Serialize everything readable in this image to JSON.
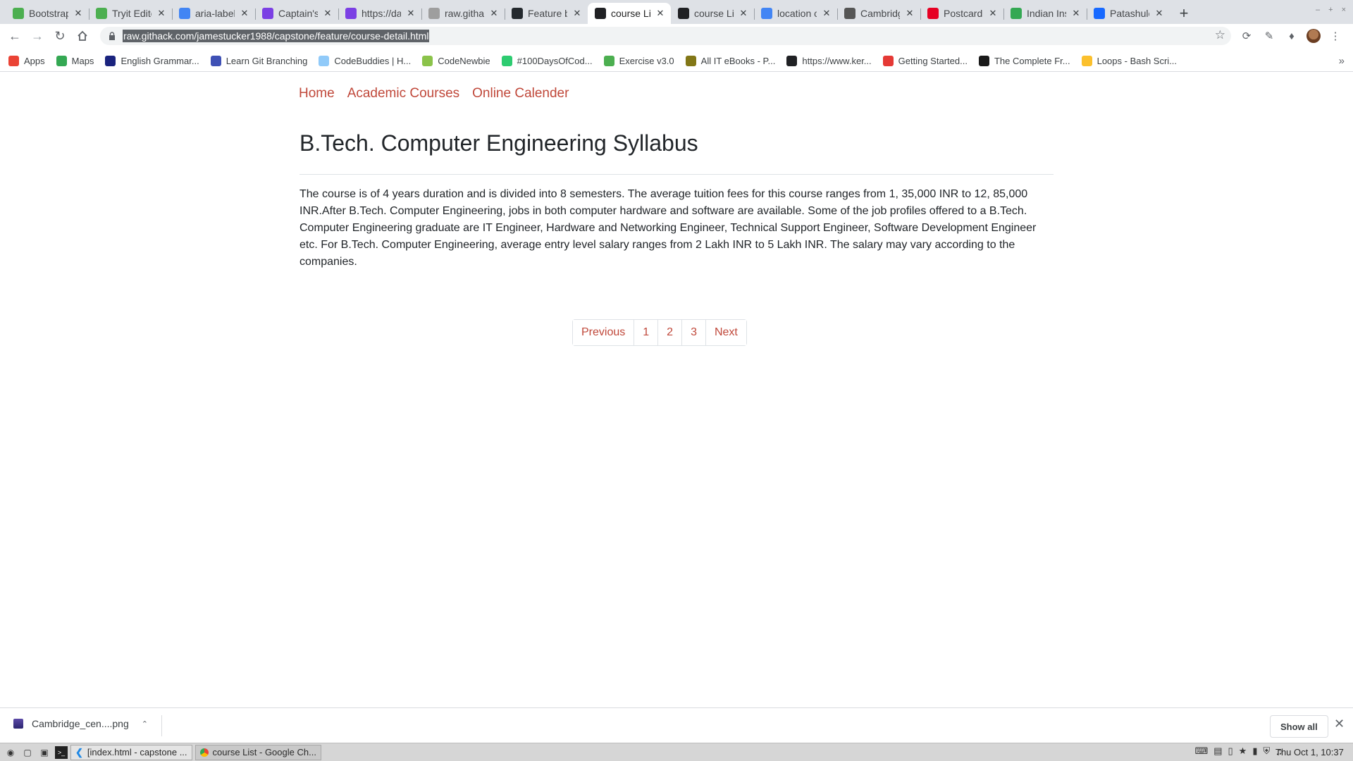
{
  "browser": {
    "tabs": [
      {
        "title": "Bootstrap",
        "icon": "tryit-icon",
        "color": "#4caf50",
        "active": false
      },
      {
        "title": "Tryit Editor",
        "icon": "tryit-icon",
        "color": "#4caf50",
        "active": false
      },
      {
        "title": "aria-label",
        "icon": "google-icon",
        "color": "#4285f4",
        "active": false
      },
      {
        "title": "Captain's Log",
        "icon": "mdn-icon",
        "color": "#7b3fe4",
        "active": false
      },
      {
        "title": "https://dat",
        "icon": "mdn-icon",
        "color": "#7b3fe4",
        "active": false
      },
      {
        "title": "raw.githack",
        "icon": "githack-icon",
        "color": "#9e9e9e",
        "active": false
      },
      {
        "title": "Feature by",
        "icon": "github-icon",
        "color": "#24292e",
        "active": false
      },
      {
        "title": "course List",
        "icon": "globe-icon",
        "color": "#202124",
        "active": true
      },
      {
        "title": "course List",
        "icon": "globe-icon",
        "color": "#202124",
        "active": false
      },
      {
        "title": "location of",
        "icon": "google-icon",
        "color": "#4285f4",
        "active": false
      },
      {
        "title": "Cambridge",
        "icon": "wikipedia-icon",
        "color": "#555555",
        "active": false
      },
      {
        "title": "Postcard",
        "icon": "pinterest-icon",
        "color": "#e60023",
        "active": false
      },
      {
        "title": "Indian Insti",
        "icon": "maps-icon",
        "color": "#34a853",
        "active": false
      },
      {
        "title": "Patashule",
        "icon": "behance-icon",
        "color": "#1769ff",
        "active": false
      }
    ],
    "url": "raw.githack.com/jamestucker1988/capstone/feature/course-detail.html",
    "bookmarks": [
      {
        "label": "Apps",
        "icon": "apps-grid-icon",
        "color": "#ea4335"
      },
      {
        "label": "Maps",
        "icon": "maps-icon",
        "color": "#34a853"
      },
      {
        "label": "English Grammar...",
        "icon": "power-icon",
        "color": "#1a237e"
      },
      {
        "label": "Learn Git Branching",
        "icon": "git-branch-icon",
        "color": "#3f51b5"
      },
      {
        "label": "CodeBuddies | H...",
        "icon": "codebuddies-icon",
        "color": "#90caf9"
      },
      {
        "label": "CodeNewbie",
        "icon": "codenewbie-icon",
        "color": "#8bc34a"
      },
      {
        "label": "#100DaysOfCod...",
        "icon": "hundred-days-icon",
        "color": "#2ecc71"
      },
      {
        "label": "Exercise v3.0",
        "icon": "tryit-icon",
        "color": "#4caf50"
      },
      {
        "label": "All IT eBooks - P...",
        "icon": "books-icon",
        "color": "#827717"
      },
      {
        "label": "https://www.ker...",
        "icon": "globe-icon",
        "color": "#202124"
      },
      {
        "label": "Getting Started...",
        "icon": "pen-icon",
        "color": "#e53935"
      },
      {
        "label": "The Complete Fr...",
        "icon": "academind-icon",
        "color": "#1a1a1a"
      },
      {
        "label": "Loops - Bash Scri...",
        "icon": "circle-icon",
        "color": "#fbc02d"
      }
    ]
  },
  "page": {
    "nav": [
      "Home",
      "Academic Courses",
      "Online Calender"
    ],
    "title": "B.Tech. Computer Engineering Syllabus",
    "description": "The course is of 4 years duration and is divided into 8 semesters. The average tuition fees for this course ranges from 1, 35,000 INR to 12, 85,000 INR.After B.Tech. Computer Engineering, jobs in both computer hardware and software are available. Some of the job profiles offered to a B.Tech. Computer Engineering graduate are IT Engineer, Hardware and Networking Engineer, Technical Support Engineer, Software Development Engineer etc. For B.Tech. Computer Engineering, average entry level salary ranges from 2 Lakh INR to 5 Lakh INR. The salary may vary according to the companies.",
    "pagination": [
      "Previous",
      "1",
      "2",
      "3",
      "Next"
    ]
  },
  "downloads": {
    "file": "Cambridge_cen....png",
    "show_all": "Show all"
  },
  "taskbar": {
    "tasks": [
      "[index.html - capstone ...",
      "course List - Google Ch..."
    ],
    "clock": "Thu Oct  1, 10:37"
  },
  "colors": {
    "link": "#c0483a",
    "text": "#212529",
    "tabstrip": "#dee1e6"
  }
}
